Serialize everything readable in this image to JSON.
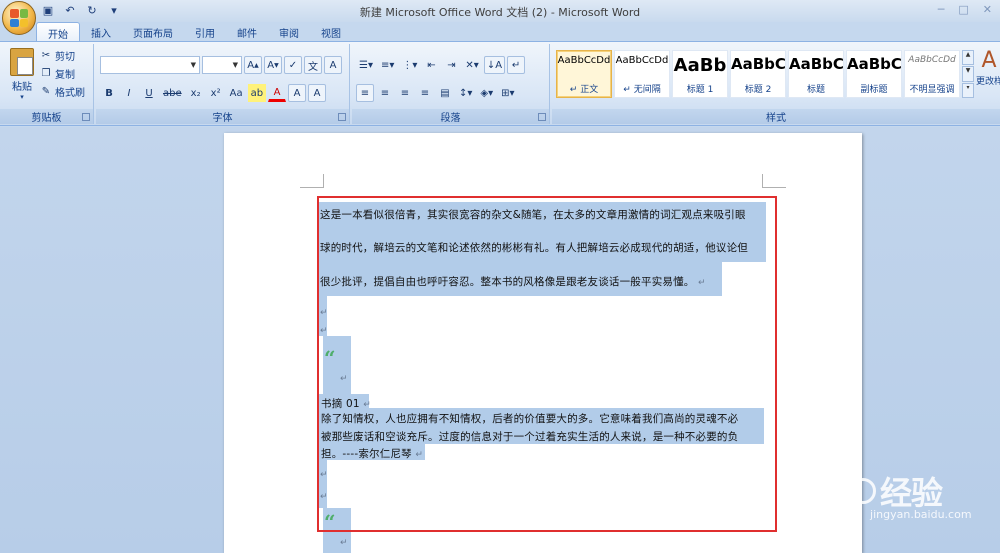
{
  "window": {
    "title": "新建 Microsoft Office Word 文档 (2) - Microsoft Word"
  },
  "tabs": [
    {
      "label": "开始",
      "active": true
    },
    {
      "label": "插入",
      "active": false
    },
    {
      "label": "页面布局",
      "active": false
    },
    {
      "label": "引用",
      "active": false
    },
    {
      "label": "邮件",
      "active": false
    },
    {
      "label": "审阅",
      "active": false
    },
    {
      "label": "视图",
      "active": false
    }
  ],
  "ribbon": {
    "clipboard": {
      "paste_label": "粘贴",
      "cut_label": "剪切",
      "copy_label": "复制",
      "format_painter_label": "格式刷",
      "group_label": "剪贴板"
    },
    "font": {
      "font_name": "",
      "font_size": "",
      "group_label": "字体",
      "buttons": [
        "B",
        "I",
        "U",
        "abe",
        "x₂",
        "x²",
        "Aa",
        "A",
        "A",
        "A",
        "A"
      ]
    },
    "paragraph": {
      "group_label": "段落"
    },
    "styles": {
      "group_label": "样式",
      "items": [
        {
          "sample": "AaBbCcDd",
          "name": "↵ 正文",
          "selected": true
        },
        {
          "sample": "AaBbCcDd",
          "name": "↵ 无间隔",
          "selected": false
        },
        {
          "sample": "AaBb",
          "name": "标题 1",
          "selected": false
        },
        {
          "sample": "AaBbC",
          "name": "标题 2",
          "selected": false
        },
        {
          "sample": "AaBbC",
          "name": "标题",
          "selected": false
        },
        {
          "sample": "AaBbC",
          "name": "副标题",
          "selected": false
        },
        {
          "sample": "AaBbCcDd",
          "name": "不明显强调",
          "selected": false
        }
      ],
      "change_styles_label": "更改样"
    }
  },
  "document": {
    "lines": [
      "这是一本看似很倍青，其实很宽容的杂文&随笔，在太多的文章用激情的词汇观点来吸引眼",
      "球的时代，解培云的文笔和论述依然的彬彬有礼。有人把解培云必成现代的胡适，他议论但",
      "很少批评，提倡自由也呼吁容忍。整本书的风格像是跟老友谈话一般平实易懂。"
    ],
    "quote_mark": "“",
    "excerpt_title": "书摘 01",
    "excerpt_lines": [
      "除了知情权，人也应拥有不知情权，后者的价值要大的多。它意味着我们高尚的灵魂不必",
      "被那些废话和空谈充斥。过度的信息对于一个过着充实生活的人来说，是一种不必要的负",
      "担。----索尔仁尼琴"
    ],
    "para_mark": "↵"
  },
  "watermark": {
    "brand_prefix": "Bai",
    "brand_suffix": "经验",
    "url": "jingyan.baidu.com"
  },
  "colors": {
    "selection": "#b2cce9",
    "highlight_box": "#e02f2f",
    "quote": "#4fae6b"
  }
}
